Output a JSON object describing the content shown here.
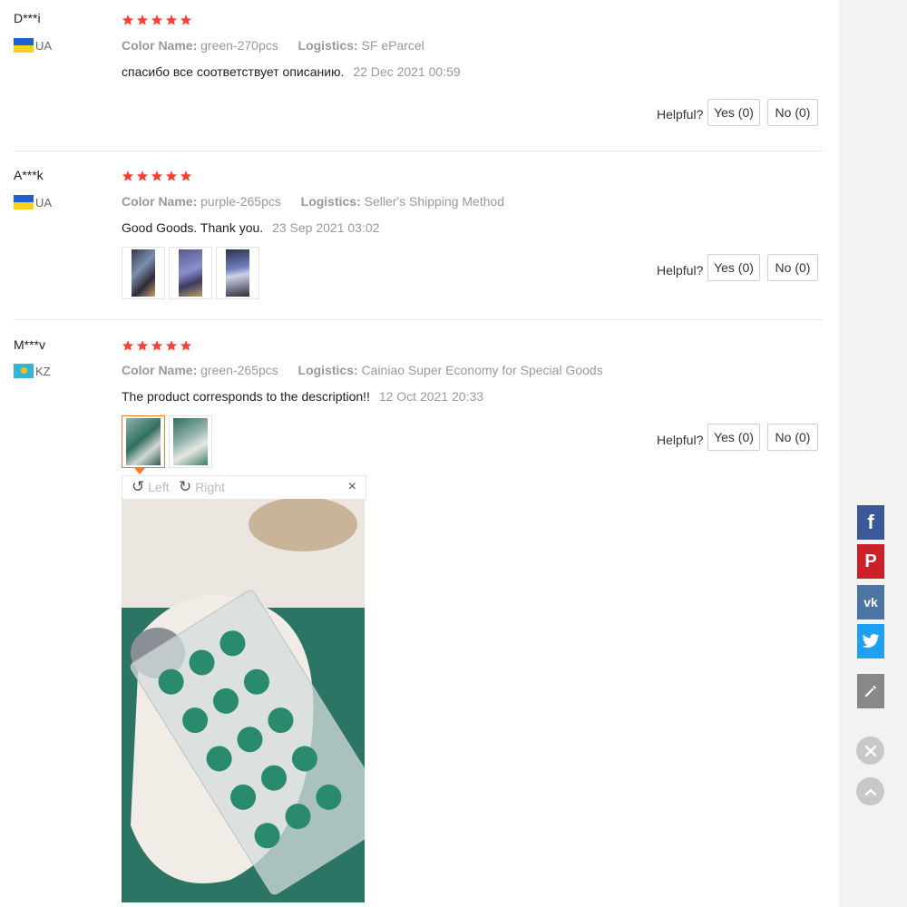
{
  "reviews": [
    {
      "user": "D***i",
      "country": "UA",
      "color_label": "Color Name:",
      "color_value": "green-270pcs",
      "logistics_label": "Logistics:",
      "logistics_value": "SF eParcel",
      "text": "спасибо все соответствует описанию.",
      "date": "22 Dec 2021 00:59",
      "rating": 5,
      "helpful": "Helpful?",
      "yes": "Yes (0)",
      "no": "No (0)"
    },
    {
      "user": "A***k",
      "country": "UA",
      "color_label": "Color Name:",
      "color_value": "purple-265pcs",
      "logistics_label": "Logistics:",
      "logistics_value": "Seller's Shipping Method",
      "text": "Good Goods. Thank you.",
      "date": "23 Sep 2021 03:02",
      "rating": 5,
      "helpful": "Helpful?",
      "yes": "Yes (0)",
      "no": "No (0)"
    },
    {
      "user": "M***v",
      "country": "KZ",
      "color_label": "Color Name:",
      "color_value": "green-265pcs",
      "logistics_label": "Logistics:",
      "logistics_value": "Cainiao Super Economy for Special Goods",
      "text": "The product corresponds to the description!!",
      "date": "12 Oct 2021 20:33",
      "rating": 5,
      "helpful": "Helpful?",
      "yes": "Yes (0)",
      "no": "No (0)"
    }
  ],
  "viewer": {
    "rotate_left": "Left",
    "rotate_right": "Right",
    "close": "×"
  },
  "colors": {
    "star": "#f44336",
    "active_thumb": "#f07b2a",
    "facebook": "#3b5998",
    "pinterest": "#cb2027",
    "vk": "#4c75a3",
    "twitter": "#1da1f2",
    "edit": "#888888"
  },
  "share_icons": [
    "facebook-icon",
    "pinterest-icon",
    "vk-icon",
    "twitter-icon",
    "edit-icon"
  ]
}
